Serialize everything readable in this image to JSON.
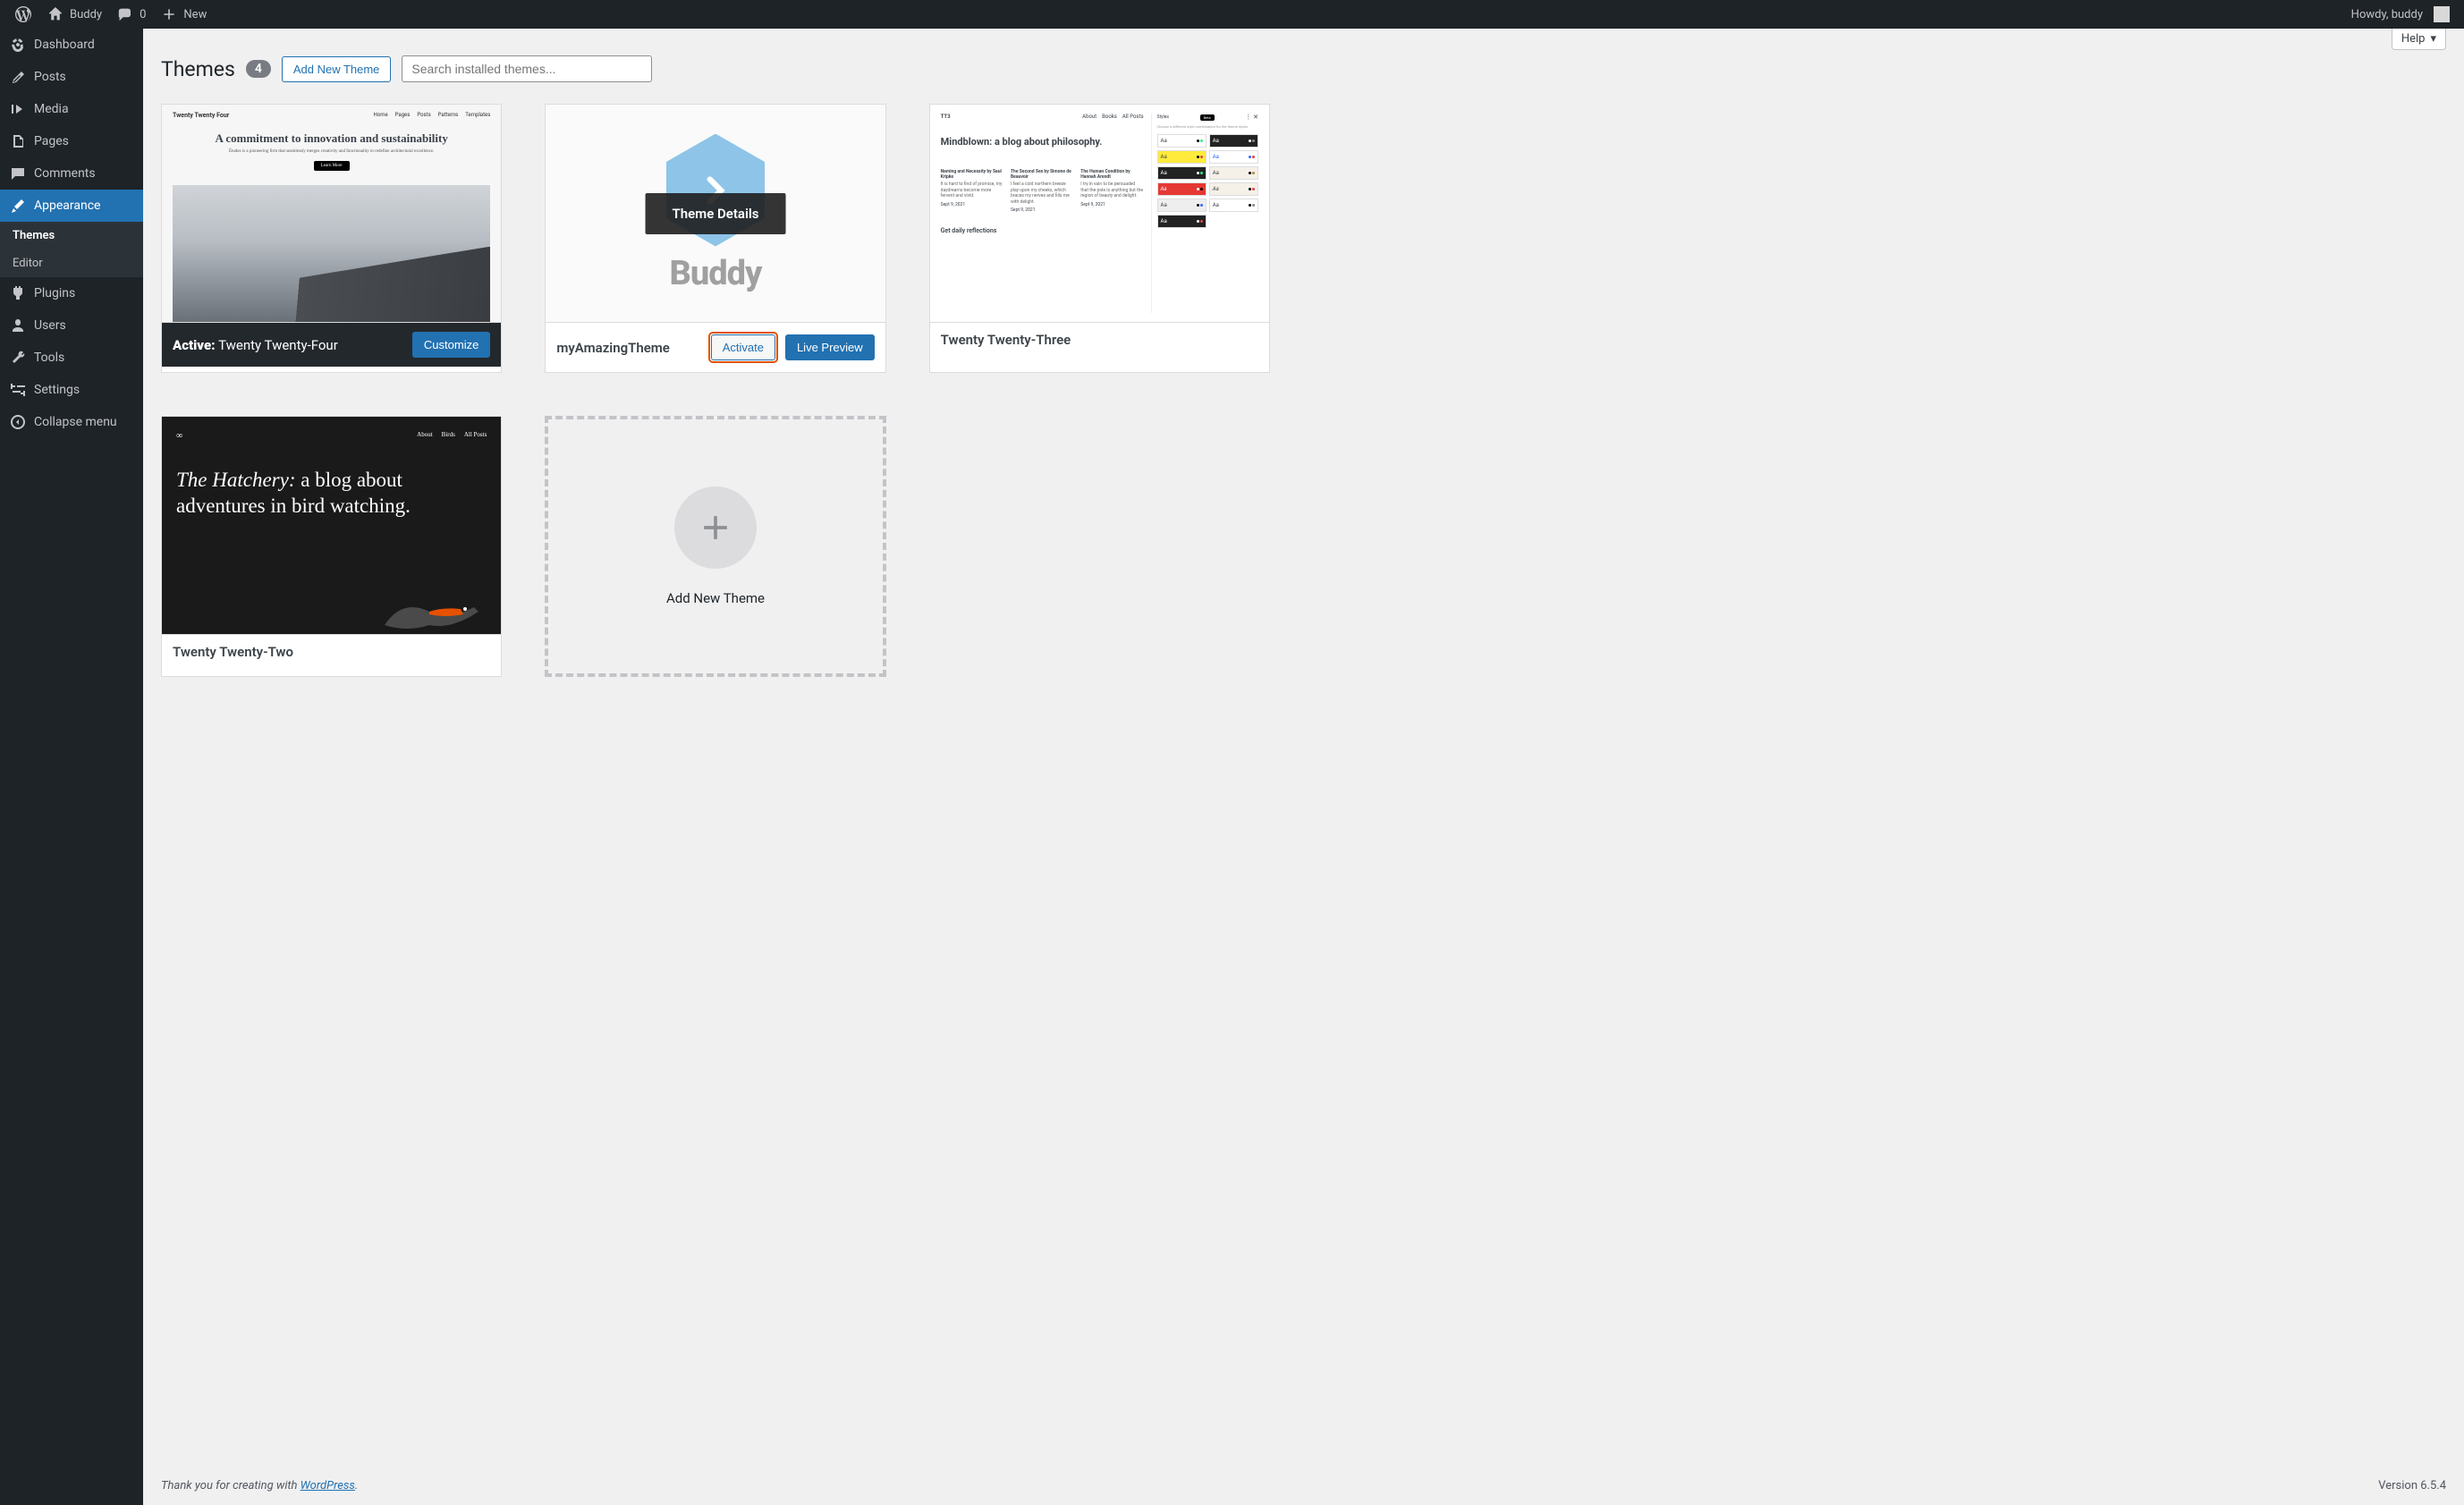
{
  "adminBar": {
    "siteName": "Buddy",
    "commentsCount": "0",
    "newLabel": "New",
    "greeting": "Howdy, buddy"
  },
  "sidebar": {
    "dashboard": "Dashboard",
    "posts": "Posts",
    "media": "Media",
    "pages": "Pages",
    "comments": "Comments",
    "appearance": "Appearance",
    "themesSub": "Themes",
    "editorSub": "Editor",
    "plugins": "Plugins",
    "users": "Users",
    "tools": "Tools",
    "settings": "Settings",
    "collapse": "Collapse menu"
  },
  "header": {
    "title": "Themes",
    "count": "4",
    "addNew": "Add New Theme",
    "searchPlaceholder": "Search installed themes...",
    "helpLabel": "Help"
  },
  "themes": {
    "active": {
      "prefix": "Active:",
      "name": " Twenty Twenty-Four",
      "customize": "Customize",
      "shot": {
        "brand": "Twenty Twenty Four",
        "nav": [
          "Home",
          "Pages",
          "Posts",
          "Patterns",
          "Templates"
        ],
        "headline": "A commitment to innovation and sustainability",
        "sub": "Études is a pioneering firm that seamlessly merges creativity and functionality to redefine architectural excellence.",
        "btn": "Learn More"
      }
    },
    "buddy": {
      "name": "myAmazingTheme",
      "activate": "Activate",
      "preview": "Live Preview",
      "details": "Theme Details",
      "text": "Buddy"
    },
    "tt23": {
      "name": "Twenty Twenty-Three",
      "shot": {
        "brand": "TT3",
        "nav": [
          "About",
          "Books",
          "All Posts"
        ],
        "headline": "Mindblown: a blog about philosophy.",
        "c1t": "Naming and Necessity by Saul Kripke",
        "c1b": "It is hard to find of promise, my daydreams become more fervent and vivid.",
        "c2t": "The Second Sex by Simone de Beauvoir",
        "c2b": "I feel a cold northern breeze play upon my cheeks, which braces my nerves and fills me with delight.",
        "c3t": "The Human Condition by Hannah Arendt",
        "c3b": "I try in vain to be persuaded that the pole is anything but the region of beauty and delight.",
        "date": "Sept 9, 2021",
        "bottom": "Get daily reflections",
        "stylesLabel": "Styles",
        "stylesPill": "Beta",
        "stylesSub": "Choose a different style combination for the theme styles"
      }
    },
    "tt22": {
      "name": "Twenty Twenty-Two",
      "shot": {
        "logo": "∞",
        "nav": [
          "About",
          "Birds",
          "All Posts"
        ],
        "headline1": "The Hatchery:",
        "headline2": " a blog about adventures in bird watching."
      }
    },
    "addNewCard": "Add New Theme"
  },
  "footer": {
    "thanks": "Thank you for creating with ",
    "wp": "WordPress",
    "period": ".",
    "version": "Version 6.5.4"
  }
}
